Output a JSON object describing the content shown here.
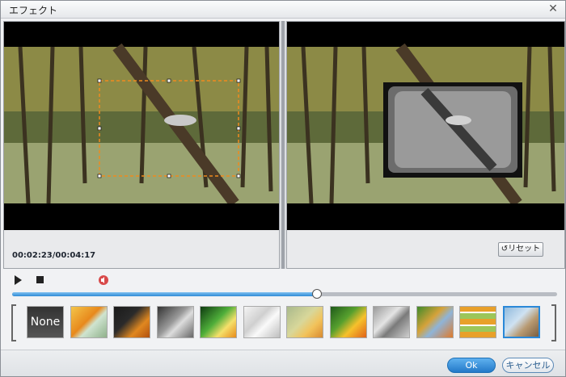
{
  "window": {
    "title": "エフェクト"
  },
  "preview": {
    "timecode": "00:02:23/00:04:17",
    "reset_label": "リセット"
  },
  "playback": {
    "progress": 0.56
  },
  "filters": {
    "items": [
      {
        "label": "None",
        "icon": "none"
      },
      {
        "icon": "filter-warm"
      },
      {
        "icon": "filter-dark"
      },
      {
        "icon": "filter-grayscale"
      },
      {
        "icon": "filter-glow"
      },
      {
        "icon": "filter-sketch"
      },
      {
        "icon": "filter-blur"
      },
      {
        "icon": "filter-vivid"
      },
      {
        "icon": "filter-emboss"
      },
      {
        "icon": "filter-pixel"
      },
      {
        "icon": "filter-mosaic"
      },
      {
        "icon": "filter-frame",
        "selected": true
      }
    ]
  },
  "dialog": {
    "ok_label": "Ok",
    "cancel_label": "キャンセル"
  }
}
